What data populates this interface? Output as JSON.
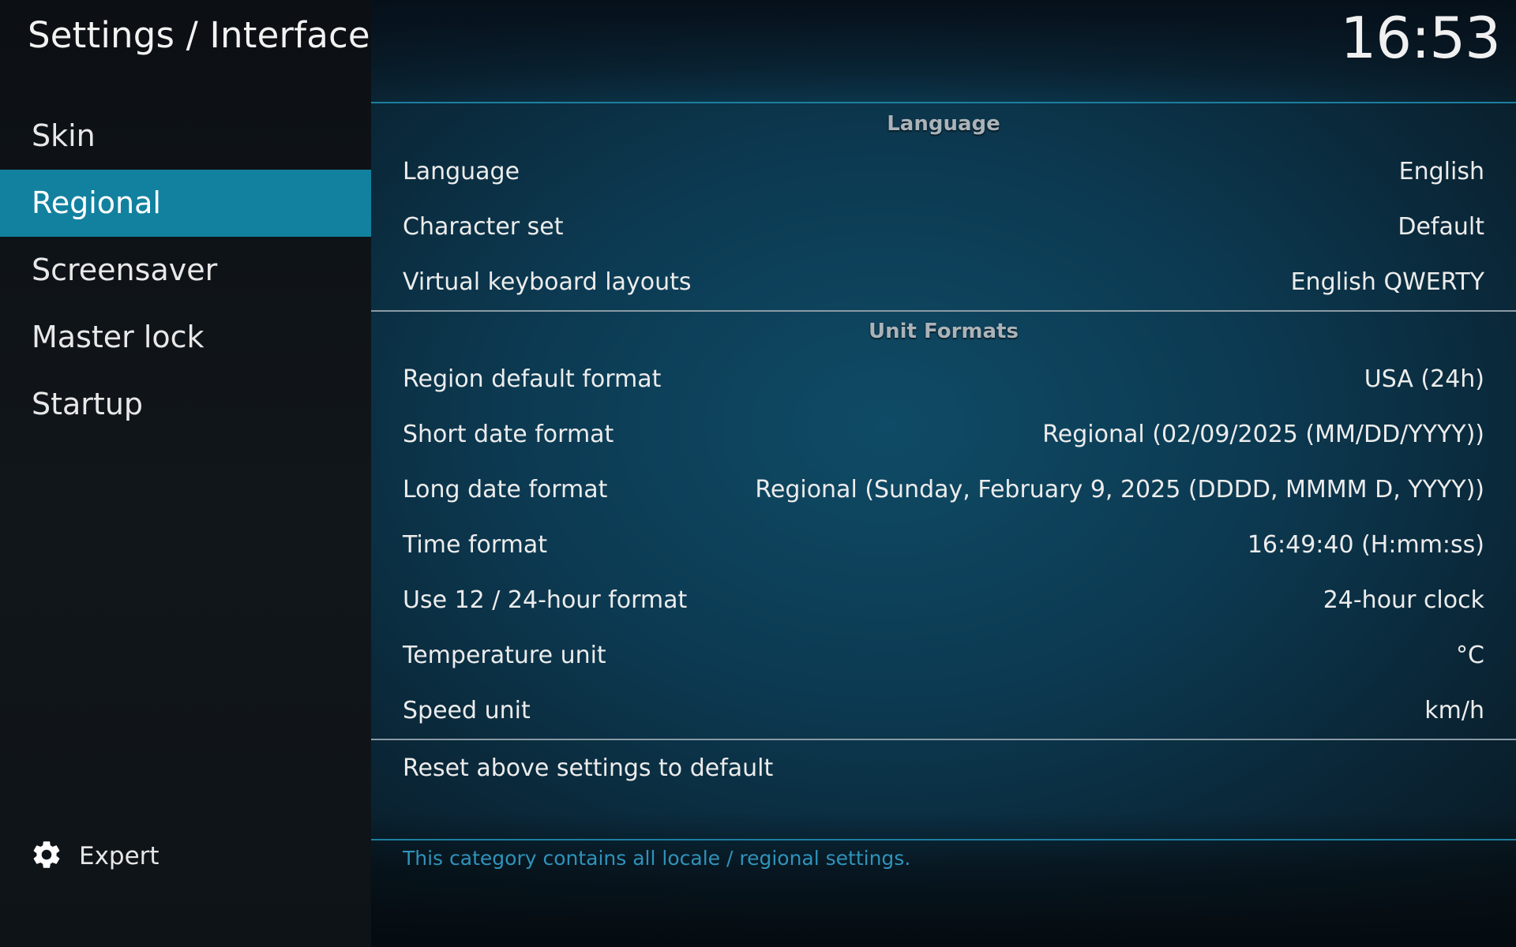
{
  "header": {
    "title": "Settings / Interface",
    "clock": "16:53"
  },
  "sidebar": {
    "items": [
      {
        "label": "Skin"
      },
      {
        "label": "Regional"
      },
      {
        "label": "Screensaver"
      },
      {
        "label": "Master lock"
      },
      {
        "label": "Startup"
      }
    ],
    "selected_index": 1,
    "level": {
      "icon": "gear-icon",
      "label": "Expert"
    }
  },
  "sections": {
    "language": {
      "header": "Language",
      "rows": [
        {
          "label": "Language",
          "value": "English"
        },
        {
          "label": "Character set",
          "value": "Default"
        },
        {
          "label": "Virtual keyboard layouts",
          "value": "English QWERTY"
        }
      ]
    },
    "unit_formats": {
      "header": "Unit Formats",
      "rows": [
        {
          "label": "Region default format",
          "value": "USA (24h)"
        },
        {
          "label": "Short date format",
          "value": "Regional (02/09/2025 (MM/DD/YYYY))"
        },
        {
          "label": "Long date format",
          "value": "Regional (Sunday, February 9, 2025 (DDDD, MMMM D, YYYY))"
        },
        {
          "label": "Time format",
          "value": "16:49:40 (H:mm:ss)"
        },
        {
          "label": "Use 12 / 24-hour format",
          "value": "24-hour clock"
        },
        {
          "label": "Temperature unit",
          "value": "°C"
        },
        {
          "label": "Speed unit",
          "value": "km/h"
        }
      ]
    },
    "reset": {
      "label": "Reset above settings to default"
    }
  },
  "description": "This category contains all locale / regional settings.",
  "colors": {
    "accent": "#12819f",
    "description_text": "#2f93bb",
    "separator_blue": "#1d7fa0"
  }
}
